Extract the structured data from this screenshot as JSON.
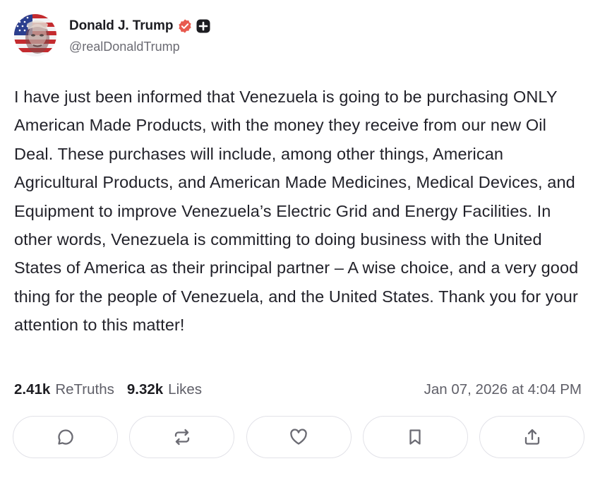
{
  "author": {
    "display_name": "Donald J. Trump",
    "handle": "@realDonaldTrump",
    "avatar_icon": "flag-portrait-avatar",
    "verified_icon": "verified-badge-icon",
    "verified_color": "#e85a4f",
    "extra_badge_icon": "plus-badge-icon"
  },
  "post": {
    "text": "I have just been informed that Venezuela is going to be purchasing ONLY American Made Products, with the money they receive from our new Oil Deal. These purchases will include, among other things, American Agricultural Products, and American Made Medicines, Medical Devices, and Equipment to improve Venezuela’s Electric Grid and Energy Facilities. In other words, Venezuela is committing to doing business with the United States of America as their principal partner – A wise choice, and a very good thing for the people of Venezuela, and the United States. Thank you for your attention to this matter!"
  },
  "stats": {
    "retruths_count": "2.41k",
    "retruths_label": "ReTruths",
    "likes_count": "9.32k",
    "likes_label": "Likes",
    "timestamp": "Jan 07, 2026 at 4:04 PM"
  },
  "actions": [
    {
      "name": "reply",
      "icon": "reply-icon"
    },
    {
      "name": "retruth",
      "icon": "retruth-icon"
    },
    {
      "name": "like",
      "icon": "heart-icon"
    },
    {
      "name": "bookmark",
      "icon": "bookmark-icon"
    },
    {
      "name": "share",
      "icon": "share-icon"
    }
  ],
  "colors": {
    "accent_blue": "#2a54e6",
    "icon_gray": "#6b6b73",
    "border": "#e2e2e8"
  }
}
